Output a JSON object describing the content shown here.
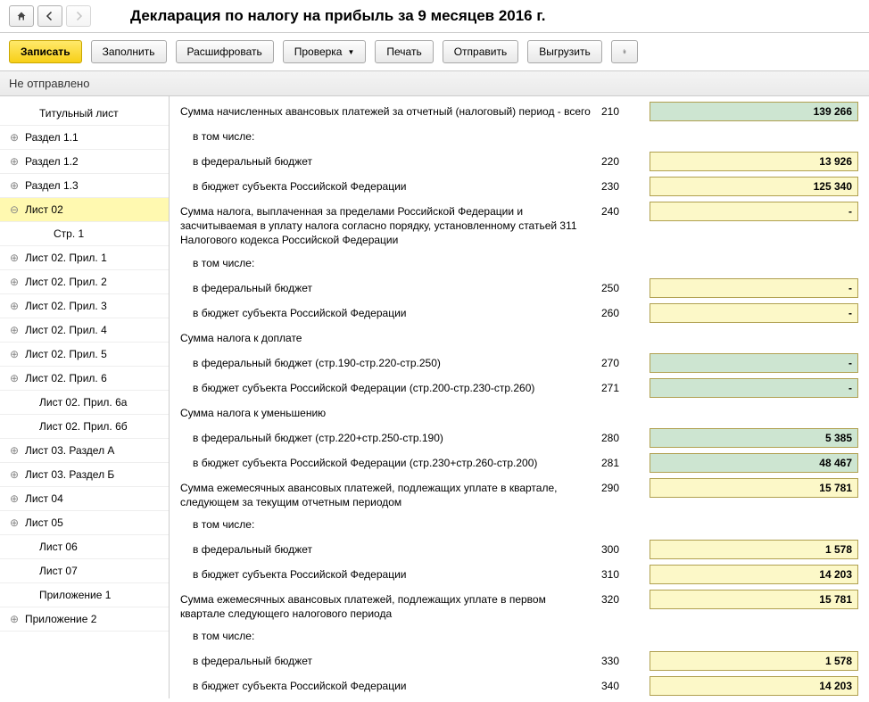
{
  "title": "Декларация по налогу на прибыль за 9 месяцев 2016 г.",
  "toolbar": {
    "write": "Записать",
    "fill": "Заполнить",
    "decode": "Расшифровать",
    "check": "Проверка",
    "print": "Печать",
    "send": "Отправить",
    "export": "Выгрузить"
  },
  "status": "Не отправлено",
  "tree": [
    {
      "label": "Титульный лист",
      "level": 1,
      "expand": "blank"
    },
    {
      "label": "Раздел 1.1",
      "level": 0,
      "expand": "plus"
    },
    {
      "label": "Раздел 1.2",
      "level": 0,
      "expand": "plus"
    },
    {
      "label": "Раздел 1.3",
      "level": 0,
      "expand": "plus"
    },
    {
      "label": "Лист 02",
      "level": 0,
      "expand": "minus",
      "selected": true
    },
    {
      "label": "Стр. 1",
      "level": 2,
      "expand": "blank"
    },
    {
      "label": "Лист 02. Прил. 1",
      "level": 0,
      "expand": "plus"
    },
    {
      "label": "Лист 02. Прил. 2",
      "level": 0,
      "expand": "plus"
    },
    {
      "label": "Лист 02. Прил. 3",
      "level": 0,
      "expand": "plus"
    },
    {
      "label": "Лист 02. Прил. 4",
      "level": 0,
      "expand": "plus"
    },
    {
      "label": "Лист 02. Прил. 5",
      "level": 0,
      "expand": "plus"
    },
    {
      "label": "Лист 02. Прил. 6",
      "level": 0,
      "expand": "plus"
    },
    {
      "label": "Лист 02. Прил. 6а",
      "level": 1,
      "expand": "blank"
    },
    {
      "label": "Лист 02. Прил. 6б",
      "level": 1,
      "expand": "blank"
    },
    {
      "label": "Лист 03. Раздел А",
      "level": 0,
      "expand": "plus"
    },
    {
      "label": "Лист 03. Раздел Б",
      "level": 0,
      "expand": "plus"
    },
    {
      "label": "Лист 04",
      "level": 0,
      "expand": "plus"
    },
    {
      "label": "Лист 05",
      "level": 0,
      "expand": "plus"
    },
    {
      "label": "Лист 06",
      "level": 1,
      "expand": "blank"
    },
    {
      "label": "Лист 07",
      "level": 1,
      "expand": "blank"
    },
    {
      "label": "Приложение 1",
      "level": 1,
      "expand": "blank"
    },
    {
      "label": "Приложение 2",
      "level": 0,
      "expand": "plus"
    }
  ],
  "rows": [
    {
      "desc": "Сумма начисленных авансовых платежей за отчетный (налоговый) период - всего",
      "code": "210",
      "value": "139 266",
      "style": "green",
      "indent": false
    },
    {
      "desc": "в том числе:",
      "code": "",
      "value": "",
      "style": "",
      "indent": true,
      "nofield": true
    },
    {
      "desc": "в федеральный бюджет",
      "code": "220",
      "value": "13 926",
      "style": "yellow",
      "indent": true
    },
    {
      "desc": "в бюджет субъекта Российской Федерации",
      "code": "230",
      "value": "125 340",
      "style": "yellow",
      "indent": true
    },
    {
      "desc": "Сумма налога, выплаченная за пределами Российской Федерации и засчитываемая в уплату налога согласно порядку, установленному статьей 311 Налогового кодекса Российской Федерации",
      "code": "240",
      "value": "-",
      "style": "yellow",
      "indent": false
    },
    {
      "desc": "в том числе:",
      "code": "",
      "value": "",
      "style": "",
      "indent": true,
      "nofield": true
    },
    {
      "desc": "в федеральный бюджет",
      "code": "250",
      "value": "-",
      "style": "yellow",
      "indent": true
    },
    {
      "desc": "в бюджет субъекта Российской Федерации",
      "code": "260",
      "value": "-",
      "style": "yellow",
      "indent": true
    },
    {
      "desc": "Сумма налога к доплате",
      "code": "",
      "value": "",
      "style": "",
      "indent": false,
      "nofield": true,
      "heading": true
    },
    {
      "desc": "в федеральный бюджет (стр.190-стр.220-стр.250)",
      "code": "270",
      "value": "-",
      "style": "green",
      "indent": true
    },
    {
      "desc": "в бюджет субъекта Российской Федерации (стр.200-стр.230-стр.260)",
      "code": "271",
      "value": "-",
      "style": "green",
      "indent": true
    },
    {
      "desc": "Сумма налога к уменьшению",
      "code": "",
      "value": "",
      "style": "",
      "indent": false,
      "nofield": true,
      "heading": true
    },
    {
      "desc": "в федеральный бюджет (стр.220+стр.250-стр.190)",
      "code": "280",
      "value": "5 385",
      "style": "green",
      "indent": true
    },
    {
      "desc": "в бюджет субъекта Российской Федерации (стр.230+стр.260-стр.200)",
      "code": "281",
      "value": "48 467",
      "style": "green",
      "indent": true
    },
    {
      "desc": "Сумма ежемесячных авансовых платежей, подлежащих уплате в квартале, следующем за текущим отчетным периодом",
      "code": "290",
      "value": "15 781",
      "style": "yellow",
      "indent": false
    },
    {
      "desc": "в том числе:",
      "code": "",
      "value": "",
      "style": "",
      "indent": true,
      "nofield": true
    },
    {
      "desc": "в федеральный бюджет",
      "code": "300",
      "value": "1 578",
      "style": "yellow",
      "indent": true
    },
    {
      "desc": "в бюджет субъекта Российской Федерации",
      "code": "310",
      "value": "14 203",
      "style": "yellow",
      "indent": true
    },
    {
      "desc": "Сумма ежемесячных авансовых платежей, подлежащих уплате в первом квартале следующего налогового периода",
      "code": "320",
      "value": "15 781",
      "style": "yellow",
      "indent": false
    },
    {
      "desc": "в том числе:",
      "code": "",
      "value": "",
      "style": "",
      "indent": true,
      "nofield": true
    },
    {
      "desc": "в федеральный бюджет",
      "code": "330",
      "value": "1 578",
      "style": "yellow",
      "indent": true
    },
    {
      "desc": "в бюджет субъекта Российской Федерации",
      "code": "340",
      "value": "14 203",
      "style": "yellow",
      "indent": true
    }
  ]
}
